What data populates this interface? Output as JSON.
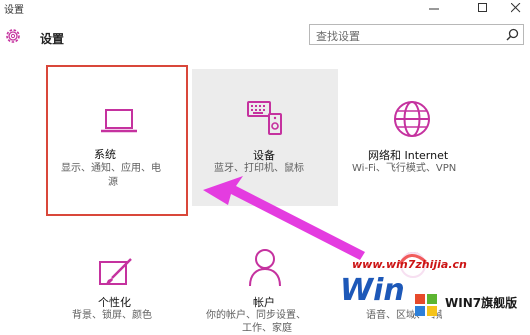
{
  "window": {
    "title": "设置"
  },
  "header": {
    "title": "设置",
    "search_placeholder": "查找设置"
  },
  "tiles": [
    {
      "title": "系统",
      "desc_line1": "显示、通知、应用、电",
      "desc_line2": "源"
    },
    {
      "title": "设备",
      "desc_line1": "蓝牙、打印机、鼠标"
    },
    {
      "title": "网络和 Internet",
      "desc_line1": "Wi-Fi、飞行模式、VPN"
    },
    {
      "title": "个性化",
      "desc_line1": "背景、锁屏、颜色"
    },
    {
      "title": "帐户",
      "desc_line1": "你的帐户、同步设置、",
      "desc_line2": "工作、家庭"
    },
    {
      "title": "",
      "desc_line1": "语音、区域、日期"
    }
  ],
  "watermark": {
    "url": "www.win7zhijia.cn",
    "badge": "WIN7旗舰版"
  },
  "colors": {
    "accent": "#c5329f",
    "highlight": "#d9473a",
    "arrow": "#e43ce0"
  }
}
